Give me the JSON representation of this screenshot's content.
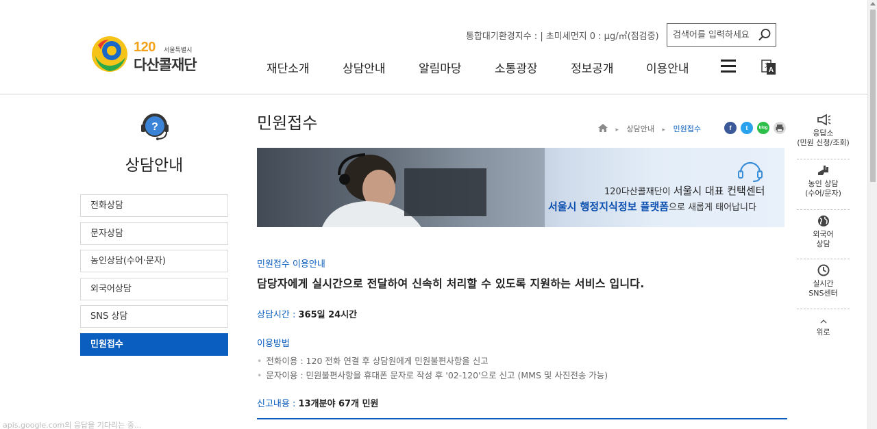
{
  "logo": {
    "num": "120",
    "city": "서울특별시",
    "name": "다산콜재단"
  },
  "header": {
    "air_info": "통합대기환경지수 : | 초미세먼지 0 : μg/㎥(점검중)",
    "search_placeholder": "검색어를 입력하세요"
  },
  "gnb": [
    "재단소개",
    "상담안내",
    "알림마당",
    "소통광장",
    "정보공개",
    "이용안내"
  ],
  "side": {
    "title": "상담안내",
    "items": [
      "전화상담",
      "문자상담",
      "농인상담(수어·문자)",
      "외국어상담",
      "SNS 상담",
      "민원접수"
    ],
    "active_index": 5
  },
  "page": {
    "title": "민원접수",
    "breadcrumb": [
      "상담안내",
      "민원접수"
    ],
    "share": [
      "f",
      "t",
      "blog",
      "print"
    ]
  },
  "banner": {
    "line1_prefix": "120다산콜재단이 ",
    "line1_em": "서울시 대표 컨택센터",
    "line2_em": "서울시 행정지식정보 플랫폼",
    "line2_suffix": "으로 새롭게 태어납니다"
  },
  "content": {
    "guide_label": "민원접수 이용안내",
    "lead": "담당자에게 실시간으로 전달하여 신속히 처리할 수 있도록 지원하는 서비스 입니다.",
    "hours_label": "상담시간 : ",
    "hours_value": "365일 24시간",
    "method_label": "이용방법",
    "methods": [
      "전화이용 : 120 전화 연결 후 상담원에게 민원불편사항을 신고",
      "문자이용 : 민원불편사항을 휴대폰 문자로 작성 후 '02-120'으로 신고 (MMS 및 사진전송 가능)"
    ],
    "report_label": "신고내용 : ",
    "report_value": "13개분야 67개 민원"
  },
  "quick": [
    {
      "line1": "응답소",
      "line2": "(민원 신청/조회)",
      "icon": "megaphone-icon"
    },
    {
      "line1": "농인 상담",
      "line2": "(수어/문자)",
      "icon": "sign-language-icon"
    },
    {
      "line1": "외국어",
      "line2": "상담",
      "icon": "globe-icon"
    },
    {
      "line1": "실시간",
      "line2": "SNS센터",
      "icon": "clock-icon"
    },
    {
      "line1": "위로",
      "line2": "",
      "icon": "chevron-up-icon"
    }
  ],
  "status_bar": "apis.google.com의 응답을 기다리는 중..."
}
